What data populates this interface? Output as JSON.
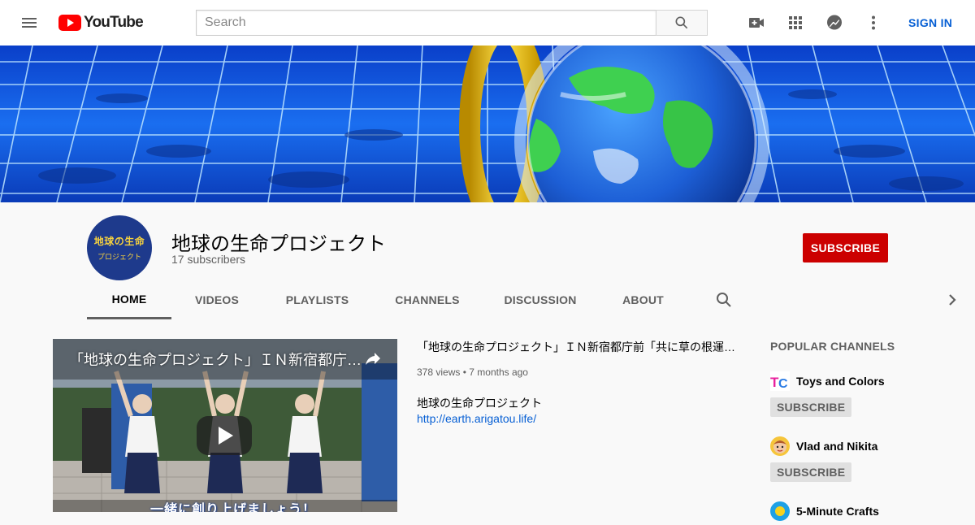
{
  "header": {
    "logo_text": "YouTube",
    "search_placeholder": "Search",
    "sign_in": "SIGN IN",
    "icons": [
      "menu-icon",
      "search-icon",
      "create-video-icon",
      "apps-icon",
      "messages-icon",
      "more-vert-icon"
    ]
  },
  "channel": {
    "name": "地球の生命プロジェクト",
    "subscribers": "17 subscribers",
    "avatar_line1": "地球の生命",
    "avatar_line2": "プロジェクト",
    "subscribe_label": "SUBSCRIBE"
  },
  "tabs": [
    "HOME",
    "VIDEOS",
    "PLAYLISTS",
    "CHANNELS",
    "DISCUSSION",
    "ABOUT"
  ],
  "featured_video": {
    "player_title": "「地球の生命プロジェクト」ＩＮ新宿都庁前「共に草の根運動",
    "caption": "一緒に創り上げましょう！",
    "title": "「地球の生命プロジェクト」ＩＮ新宿都庁前「共に草の根運動を！」",
    "views": "378 views",
    "time": "7 months ago",
    "description": "地球の生命プロジェクト",
    "link": "http://earth.arigatou.life/"
  },
  "popular_channels": {
    "title": "POPULAR CHANNELS",
    "items": [
      {
        "name": "Toys and Colors",
        "subscribe": "SUBSCRIBE"
      },
      {
        "name": "Vlad and Nikita",
        "subscribe": "SUBSCRIBE"
      },
      {
        "name": "5-Minute Crafts",
        "subscribe": "SUBSCRIBE"
      }
    ]
  },
  "colors": {
    "accent_red": "#cc0000",
    "link_blue": "#065fd4",
    "logo_red": "#ff0000"
  }
}
